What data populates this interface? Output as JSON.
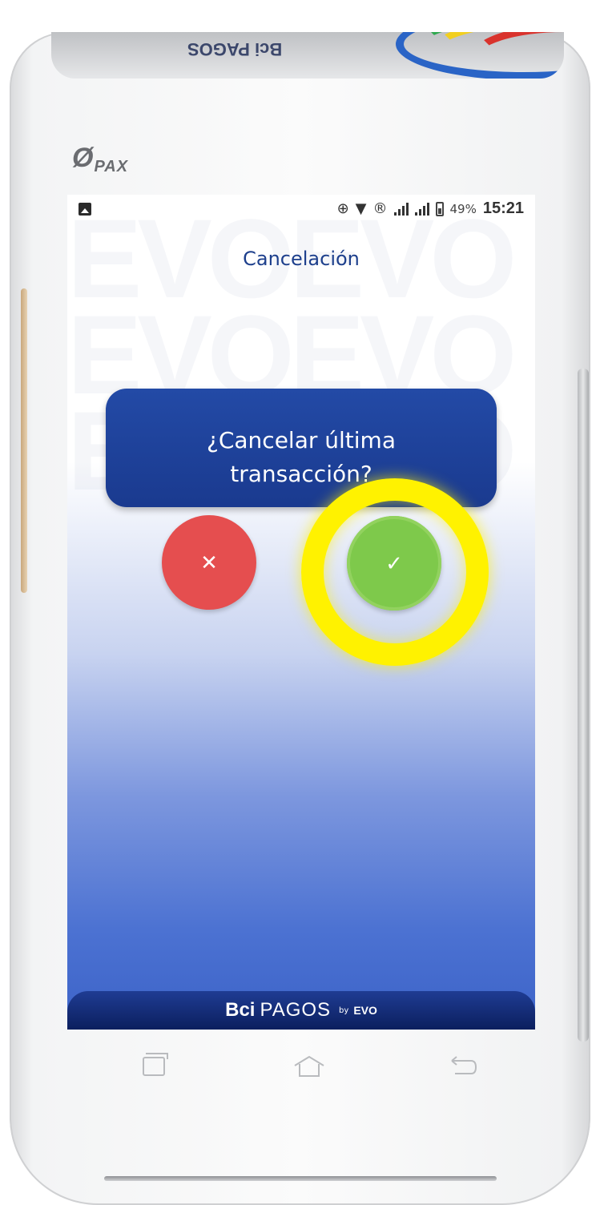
{
  "device": {
    "top_brand": "Bci PAGOS",
    "maker_logo": "PAX"
  },
  "status_bar": {
    "icons": [
      "image-icon",
      "add-circle-icon",
      "wifi-icon",
      "vpn-icon",
      "signal-icon",
      "signal-icon",
      "battery-icon"
    ],
    "battery": "49%",
    "time": "15:21"
  },
  "screen": {
    "title": "Cancelación",
    "question": "¿Cancelar última transacción?",
    "cancel_button": {
      "label": "✕",
      "color": "#e54e4f"
    },
    "confirm_button": {
      "label": "✓",
      "color": "#7ec94b"
    },
    "highlight_color": "#fff200"
  },
  "footer": {
    "brand_bci": "Bci",
    "brand_pagos": "PAGOS",
    "brand_by": "by",
    "brand_evo": "EVO"
  },
  "nav_keys": [
    "recent-apps-icon",
    "home-icon",
    "back-icon"
  ]
}
